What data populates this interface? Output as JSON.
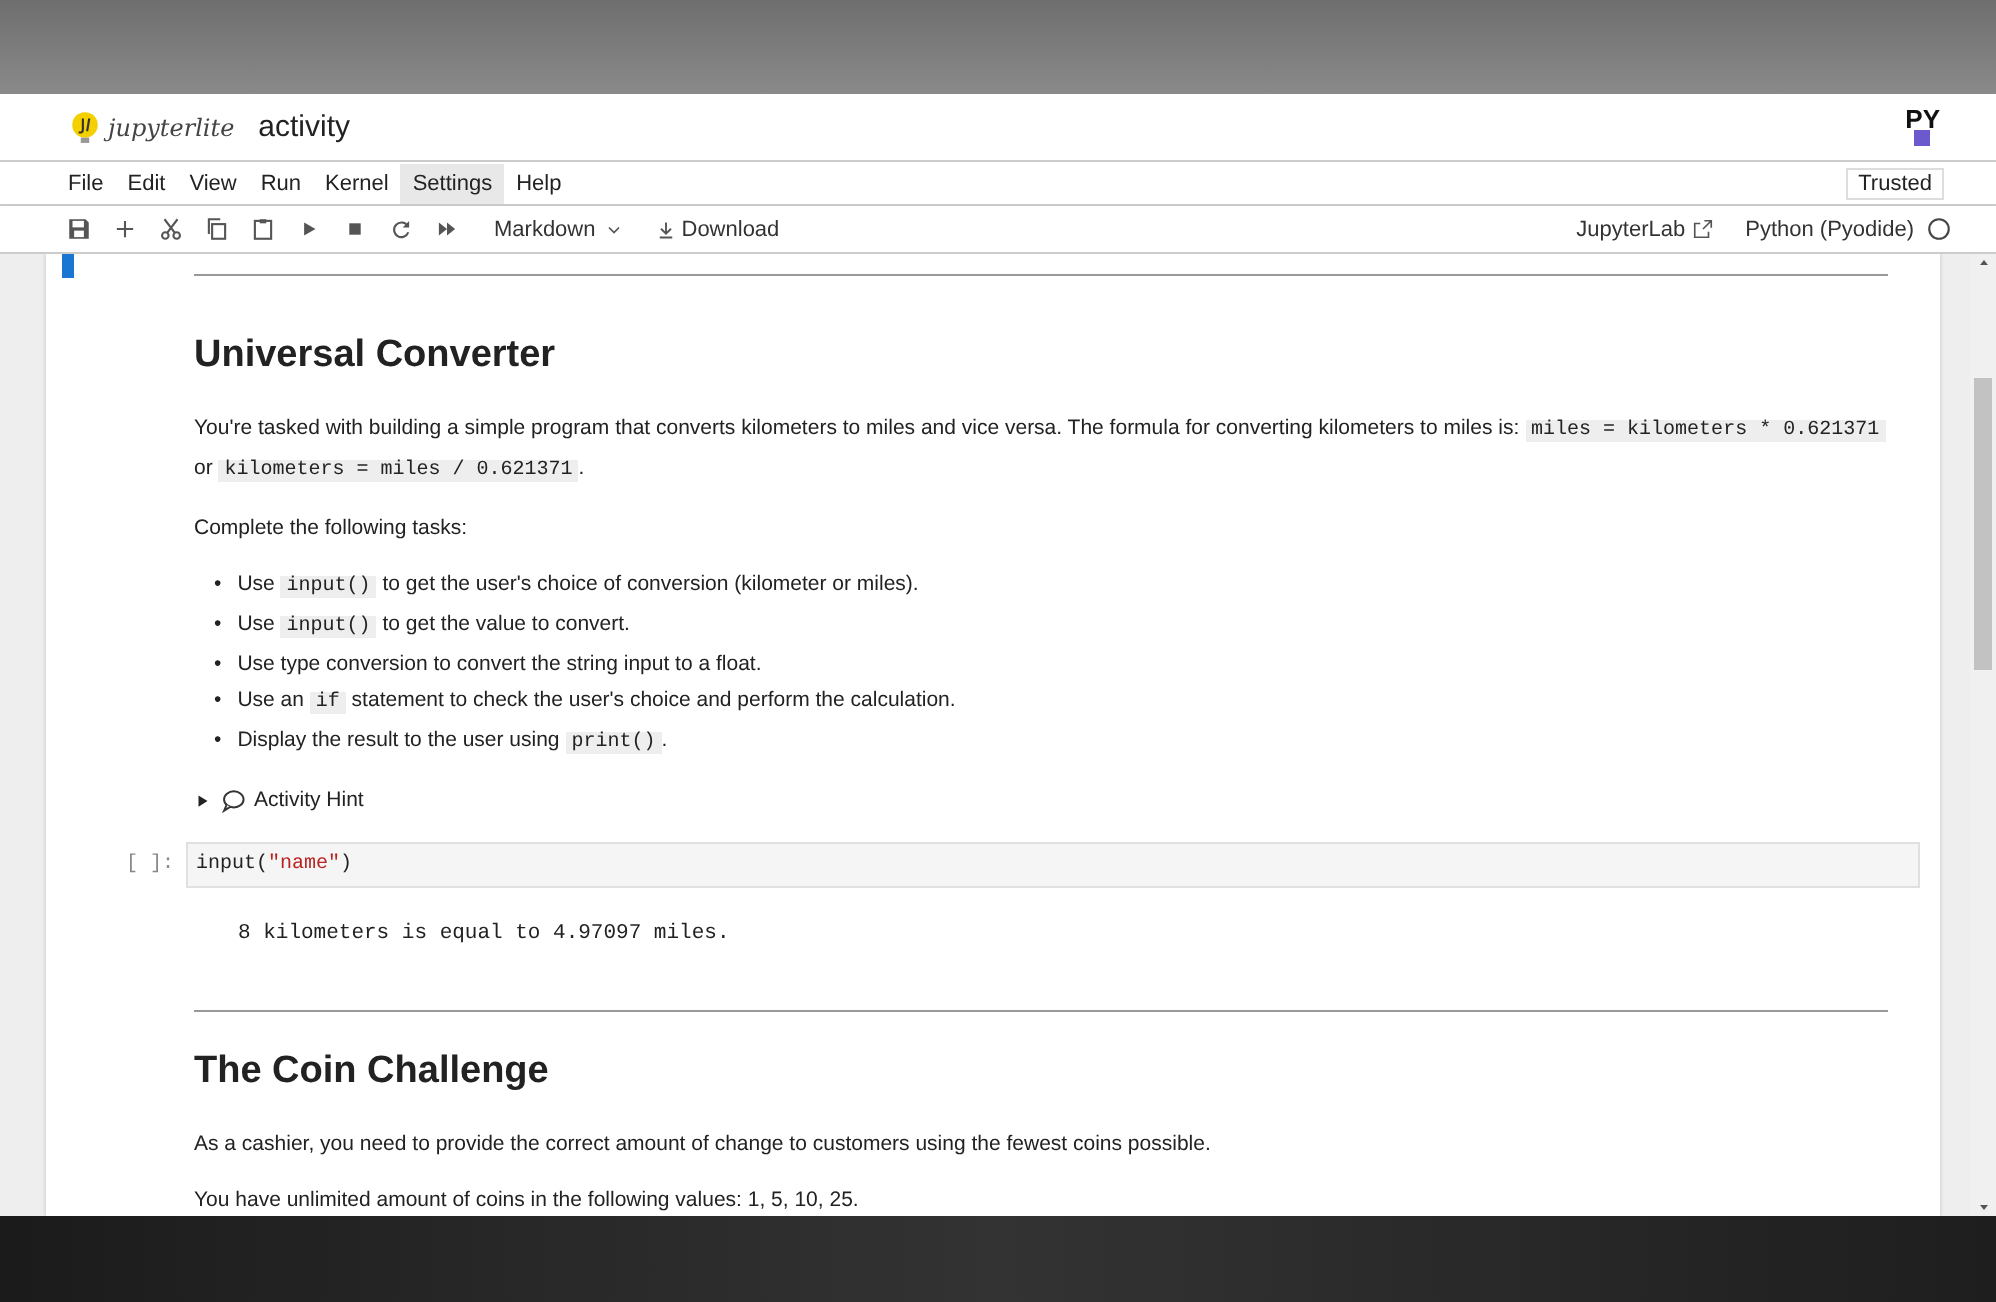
{
  "header": {
    "logo_text": "jupyterlite",
    "title": "activity",
    "kernel_logo": "PY"
  },
  "menu": [
    {
      "label": "File",
      "selected": false
    },
    {
      "label": "Edit",
      "selected": false
    },
    {
      "label": "View",
      "selected": false
    },
    {
      "label": "Run",
      "selected": false
    },
    {
      "label": "Kernel",
      "selected": false
    },
    {
      "label": "Settings",
      "selected": true
    },
    {
      "label": "Help",
      "selected": false
    }
  ],
  "trusted": "Trusted",
  "toolbar": {
    "buttons": [
      {
        "kind": "save"
      },
      {
        "kind": "add"
      },
      {
        "kind": "cut"
      },
      {
        "kind": "copy"
      },
      {
        "kind": "paste"
      },
      {
        "kind": "run"
      },
      {
        "kind": "stop"
      },
      {
        "kind": "restart"
      },
      {
        "kind": "run-all"
      }
    ],
    "cell_type": "Markdown",
    "download": "Download",
    "jupyterlab": "JupyterLab",
    "kernel": "Python (Pyodide)",
    "kernel_busy": false
  },
  "cells": [
    {
      "kind": "markdown",
      "active": true,
      "blocks": [
        {
          "kind": "hr"
        }
      ]
    },
    {
      "kind": "markdown",
      "active": false,
      "blocks": [
        {
          "kind": "h1",
          "text": "Universal Converter"
        },
        {
          "kind": "p",
          "segments": [
            {
              "text": "You're tasked with building a simple program that converts kilometers to miles and vice versa. The formula for converting kilometers to miles is: ",
              "kind": "text"
            },
            {
              "text": "miles = kilometers * 0.621371",
              "kind": "code"
            },
            {
              "text": " or ",
              "kind": "text"
            },
            {
              "text": "kilometers = miles / 0.621371",
              "kind": "code"
            },
            {
              "text": ".",
              "kind": "text"
            }
          ]
        },
        {
          "kind": "p",
          "segments": [
            {
              "text": "Complete the following tasks:",
              "kind": "text"
            }
          ]
        },
        {
          "kind": "ul",
          "marker": "•",
          "items": [
            [
              {
                "text": "Use ",
                "kind": "text"
              },
              {
                "text": "input()",
                "kind": "code"
              },
              {
                "text": " to get the user's choice of conversion (kilometer or miles).",
                "kind": "text"
              }
            ],
            [
              {
                "text": "Use ",
                "kind": "text"
              },
              {
                "text": "input()",
                "kind": "code"
              },
              {
                "text": " to get the value to convert.",
                "kind": "text"
              }
            ],
            [
              {
                "text": "Use type conversion to convert the string input to a float.",
                "kind": "text"
              }
            ],
            [
              {
                "text": "Use an ",
                "kind": "text"
              },
              {
                "text": "if",
                "kind": "code"
              },
              {
                "text": " statement to check the user's choice and perform the calculation.",
                "kind": "text"
              }
            ],
            [
              {
                "text": "Display the result to the user using ",
                "kind": "text"
              },
              {
                "text": "print()",
                "kind": "code"
              },
              {
                "text": ".",
                "kind": "text"
              }
            ]
          ]
        },
        {
          "kind": "details",
          "summary": "Activity Hint",
          "expanded": false
        }
      ]
    },
    {
      "kind": "code",
      "active": false,
      "prompt": "[ ]:",
      "code": [
        {
          "text": "input(",
          "kind": "plain"
        },
        {
          "text": "\"name\"",
          "kind": "string"
        },
        {
          "text": ")",
          "kind": "plain"
        }
      ],
      "output": "8 kilometers is equal to 4.97097 miles."
    },
    {
      "kind": "markdown",
      "active": false,
      "blocks": [
        {
          "kind": "hr"
        },
        {
          "kind": "h1",
          "text": "The Coin Challenge"
        },
        {
          "kind": "p",
          "segments": [
            {
              "text": "As a cashier, you need to provide the correct amount of change to customers using the fewest coins possible.",
              "kind": "text"
            }
          ]
        },
        {
          "kind": "p",
          "segments": [
            {
              "text": "You have unlimited amount of coins in the following values: 1, 5, 10, 25.",
              "kind": "text"
            }
          ]
        }
      ]
    }
  ]
}
